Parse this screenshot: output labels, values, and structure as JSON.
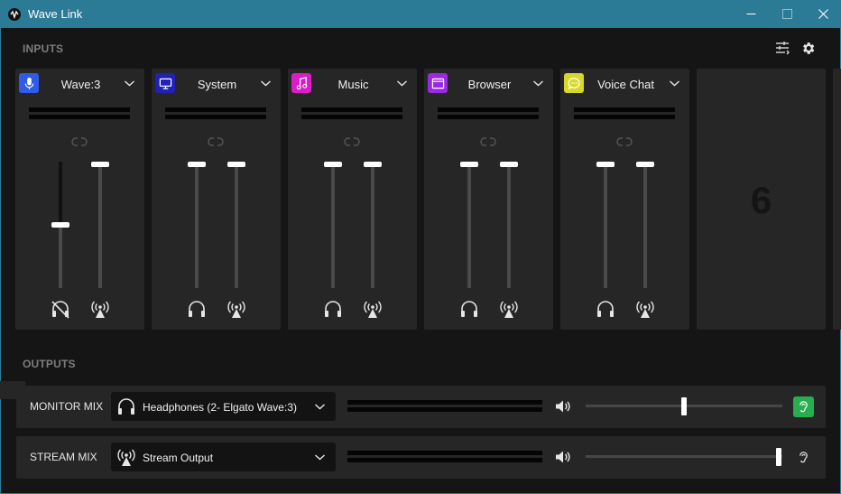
{
  "window": {
    "title": "Wave Link",
    "logo_icon": "wave-link-logo-icon"
  },
  "inputs": {
    "heading": "INPUTS",
    "toolbar_icons": [
      "mixer-settings-icon",
      "gear-icon"
    ],
    "channels": [
      {
        "name": "Wave:3",
        "icon": "microphone-icon",
        "color": "#2f5be8",
        "monitor_level": 0.5,
        "stream_level": 1.0,
        "monitor_muted": true,
        "stream_muted": false
      },
      {
        "name": "System",
        "icon": "monitor-icon",
        "color": "#2121b8",
        "monitor_level": 1.0,
        "stream_level": 1.0,
        "monitor_muted": false,
        "stream_muted": false
      },
      {
        "name": "Music",
        "icon": "music-note-icon",
        "color": "#d91ec7",
        "monitor_level": 1.0,
        "stream_level": 1.0,
        "monitor_muted": false,
        "stream_muted": false
      },
      {
        "name": "Browser",
        "icon": "browser-window-icon",
        "color": "#9b29e3",
        "monitor_level": 1.0,
        "stream_level": 1.0,
        "monitor_muted": false,
        "stream_muted": false
      },
      {
        "name": "Voice Chat",
        "icon": "chat-bubble-icon",
        "color": "#d7d92a",
        "monitor_level": 1.0,
        "stream_level": 1.0,
        "monitor_muted": false,
        "stream_muted": false
      }
    ],
    "empty_slot_number": "6"
  },
  "outputs": {
    "heading": "OUTPUTS",
    "rows": [
      {
        "label": "MONITOR MIX",
        "device": "Headphones (2- Elgato Wave:3)",
        "device_icon": "headphones-icon",
        "volume": 0.5,
        "listen_active": true,
        "listen_color": "#27ae4f"
      },
      {
        "label": "STREAM MIX",
        "device": "Stream Output",
        "device_icon": "broadcast-icon",
        "volume": 1.0,
        "listen_active": false,
        "listen_color": "#262626"
      }
    ]
  }
}
